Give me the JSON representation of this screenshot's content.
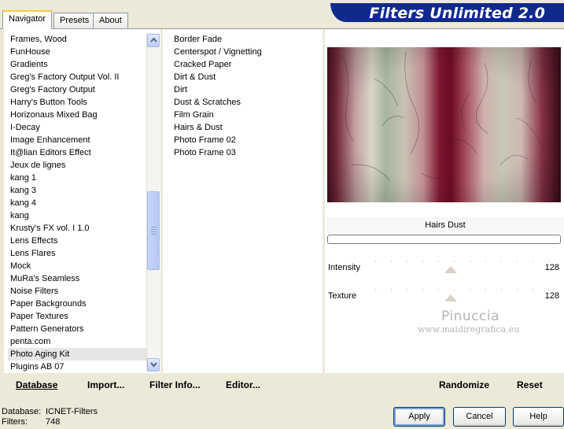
{
  "tabs": [
    {
      "label": "Navigator",
      "active": true
    },
    {
      "label": "Presets",
      "active": false
    },
    {
      "label": "About",
      "active": false
    }
  ],
  "banner": {
    "title": "Filters Unlimited 2.0"
  },
  "categories": [
    "Frames, Wood",
    "FunHouse",
    "Gradients",
    "Greg's Factory Output Vol. II",
    "Greg's Factory Output",
    "Harry's Button Tools",
    "Horizonaus Mixed Bag",
    "I-Decay",
    "Image Enhancement",
    "It@lian Editors Effect",
    "Jeux de lignes",
    "kang 1",
    "kang 3",
    "kang 4",
    "kang",
    "Krusty's FX vol. I 1.0",
    "Lens Effects",
    "Lens Flares",
    "Mock",
    "MuRa's Seamless",
    "Noise Filters",
    "Paper Backgrounds",
    "Paper Textures",
    "Pattern Generators",
    "penta.com",
    "Photo Aging Kit",
    "Plugins AB 07"
  ],
  "selected_category": "Photo Aging Kit",
  "filters": [
    "Border Fade",
    "Centerspot / Vignetting",
    "Cracked Paper",
    "Dirt & Dust",
    "Dirt",
    "Dust & Scratches",
    "Film Grain",
    "Hairs & Dust",
    "Photo Frame 02",
    "Photo Frame 03"
  ],
  "selected_filter": "Hairs & Dust",
  "scrollbar": {
    "up_icon": "chevron-up-icon",
    "down_icon": "chevron-down-icon"
  },
  "filter_title": "Hairs  Dust",
  "params": [
    {
      "label": "Intensity",
      "value": "128",
      "level": 0.5
    },
    {
      "label": "Texture",
      "value": "128",
      "level": 0.5
    }
  ],
  "watermark": {
    "line1": "Pinuccia",
    "line2": "www.maidiregrafica.eu"
  },
  "toolbar": {
    "database": "Database",
    "import": "Import...",
    "filter_info": "Filter Info...",
    "editor": "Editor...",
    "randomize": "Randomize",
    "reset": "Reset"
  },
  "status": {
    "database_label": "Database:",
    "database_value": "ICNET-Filters",
    "filters_label": "Filters:",
    "filters_value": "748"
  },
  "buttons": {
    "apply": "Apply",
    "cancel": "Cancel",
    "help": "Help"
  },
  "colors": {
    "banner": "#102a8c",
    "selection": "#316ac5",
    "tab_highlight": "#ffc83c"
  }
}
